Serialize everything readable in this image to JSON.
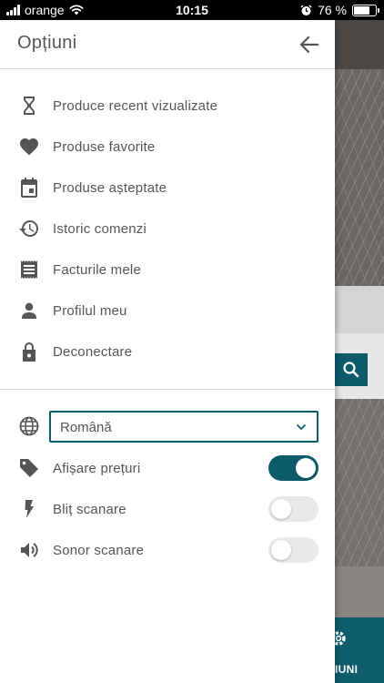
{
  "status_bar": {
    "carrier": "orange",
    "time": "10:15",
    "battery_percent": "76 %",
    "battery_level": 0.76
  },
  "drawer": {
    "title": "Opțiuni",
    "back_icon": "arrow-left-icon",
    "menu_items": [
      {
        "label": "Produce recent vizualizate",
        "icon": "hourglass-icon"
      },
      {
        "label": "Produse favorite",
        "icon": "heart-icon"
      },
      {
        "label": "Produse așteptate",
        "icon": "calendar-icon"
      },
      {
        "label": "Istoric comenzi",
        "icon": "history-icon"
      },
      {
        "label": "Facturile mele",
        "icon": "receipt-icon"
      },
      {
        "label": "Profilul meu",
        "icon": "person-icon"
      },
      {
        "label": "Deconectare",
        "icon": "lock-icon"
      }
    ],
    "language": {
      "icon": "globe-icon",
      "selected": "Română"
    },
    "settings": [
      {
        "label": "Afișare prețuri",
        "icon": "tag-icon",
        "enabled": true
      },
      {
        "label": "Bliț scanare",
        "icon": "flash-icon",
        "enabled": false
      },
      {
        "label": "Sonor scanare",
        "icon": "volume-icon",
        "enabled": false
      }
    ]
  },
  "background_app": {
    "nav_label": "IUNI"
  },
  "colors": {
    "accent": "#0c5b6c",
    "text": "#555555",
    "icon": "#555555",
    "toggle_off": "#e9e9e9"
  }
}
